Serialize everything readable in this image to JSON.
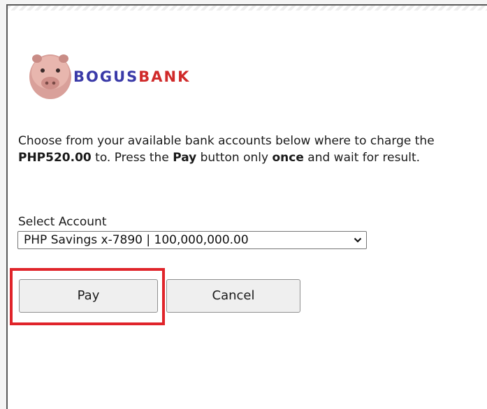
{
  "logo": {
    "part1": "BOGUS",
    "part2": "BANK",
    "icon": "piggy-bank-icon",
    "colors": {
      "part1": "#3a3aa8",
      "part2": "#d02a2a"
    }
  },
  "message": {
    "t1": "Choose from your available bank accounts below where to charge the ",
    "amount": "PHP520.00",
    "t2": " to. Press the ",
    "pay_word": "Pay",
    "t3": " button only ",
    "once_word": "once",
    "t4": " and wait for result."
  },
  "account_select": {
    "label": "Select Account",
    "selected": "PHP Savings x-7890 | 100,000,000.00",
    "icon": "chevron-down-icon"
  },
  "buttons": {
    "pay": "Pay",
    "cancel": "Cancel"
  },
  "highlight_color": "#e0242a"
}
